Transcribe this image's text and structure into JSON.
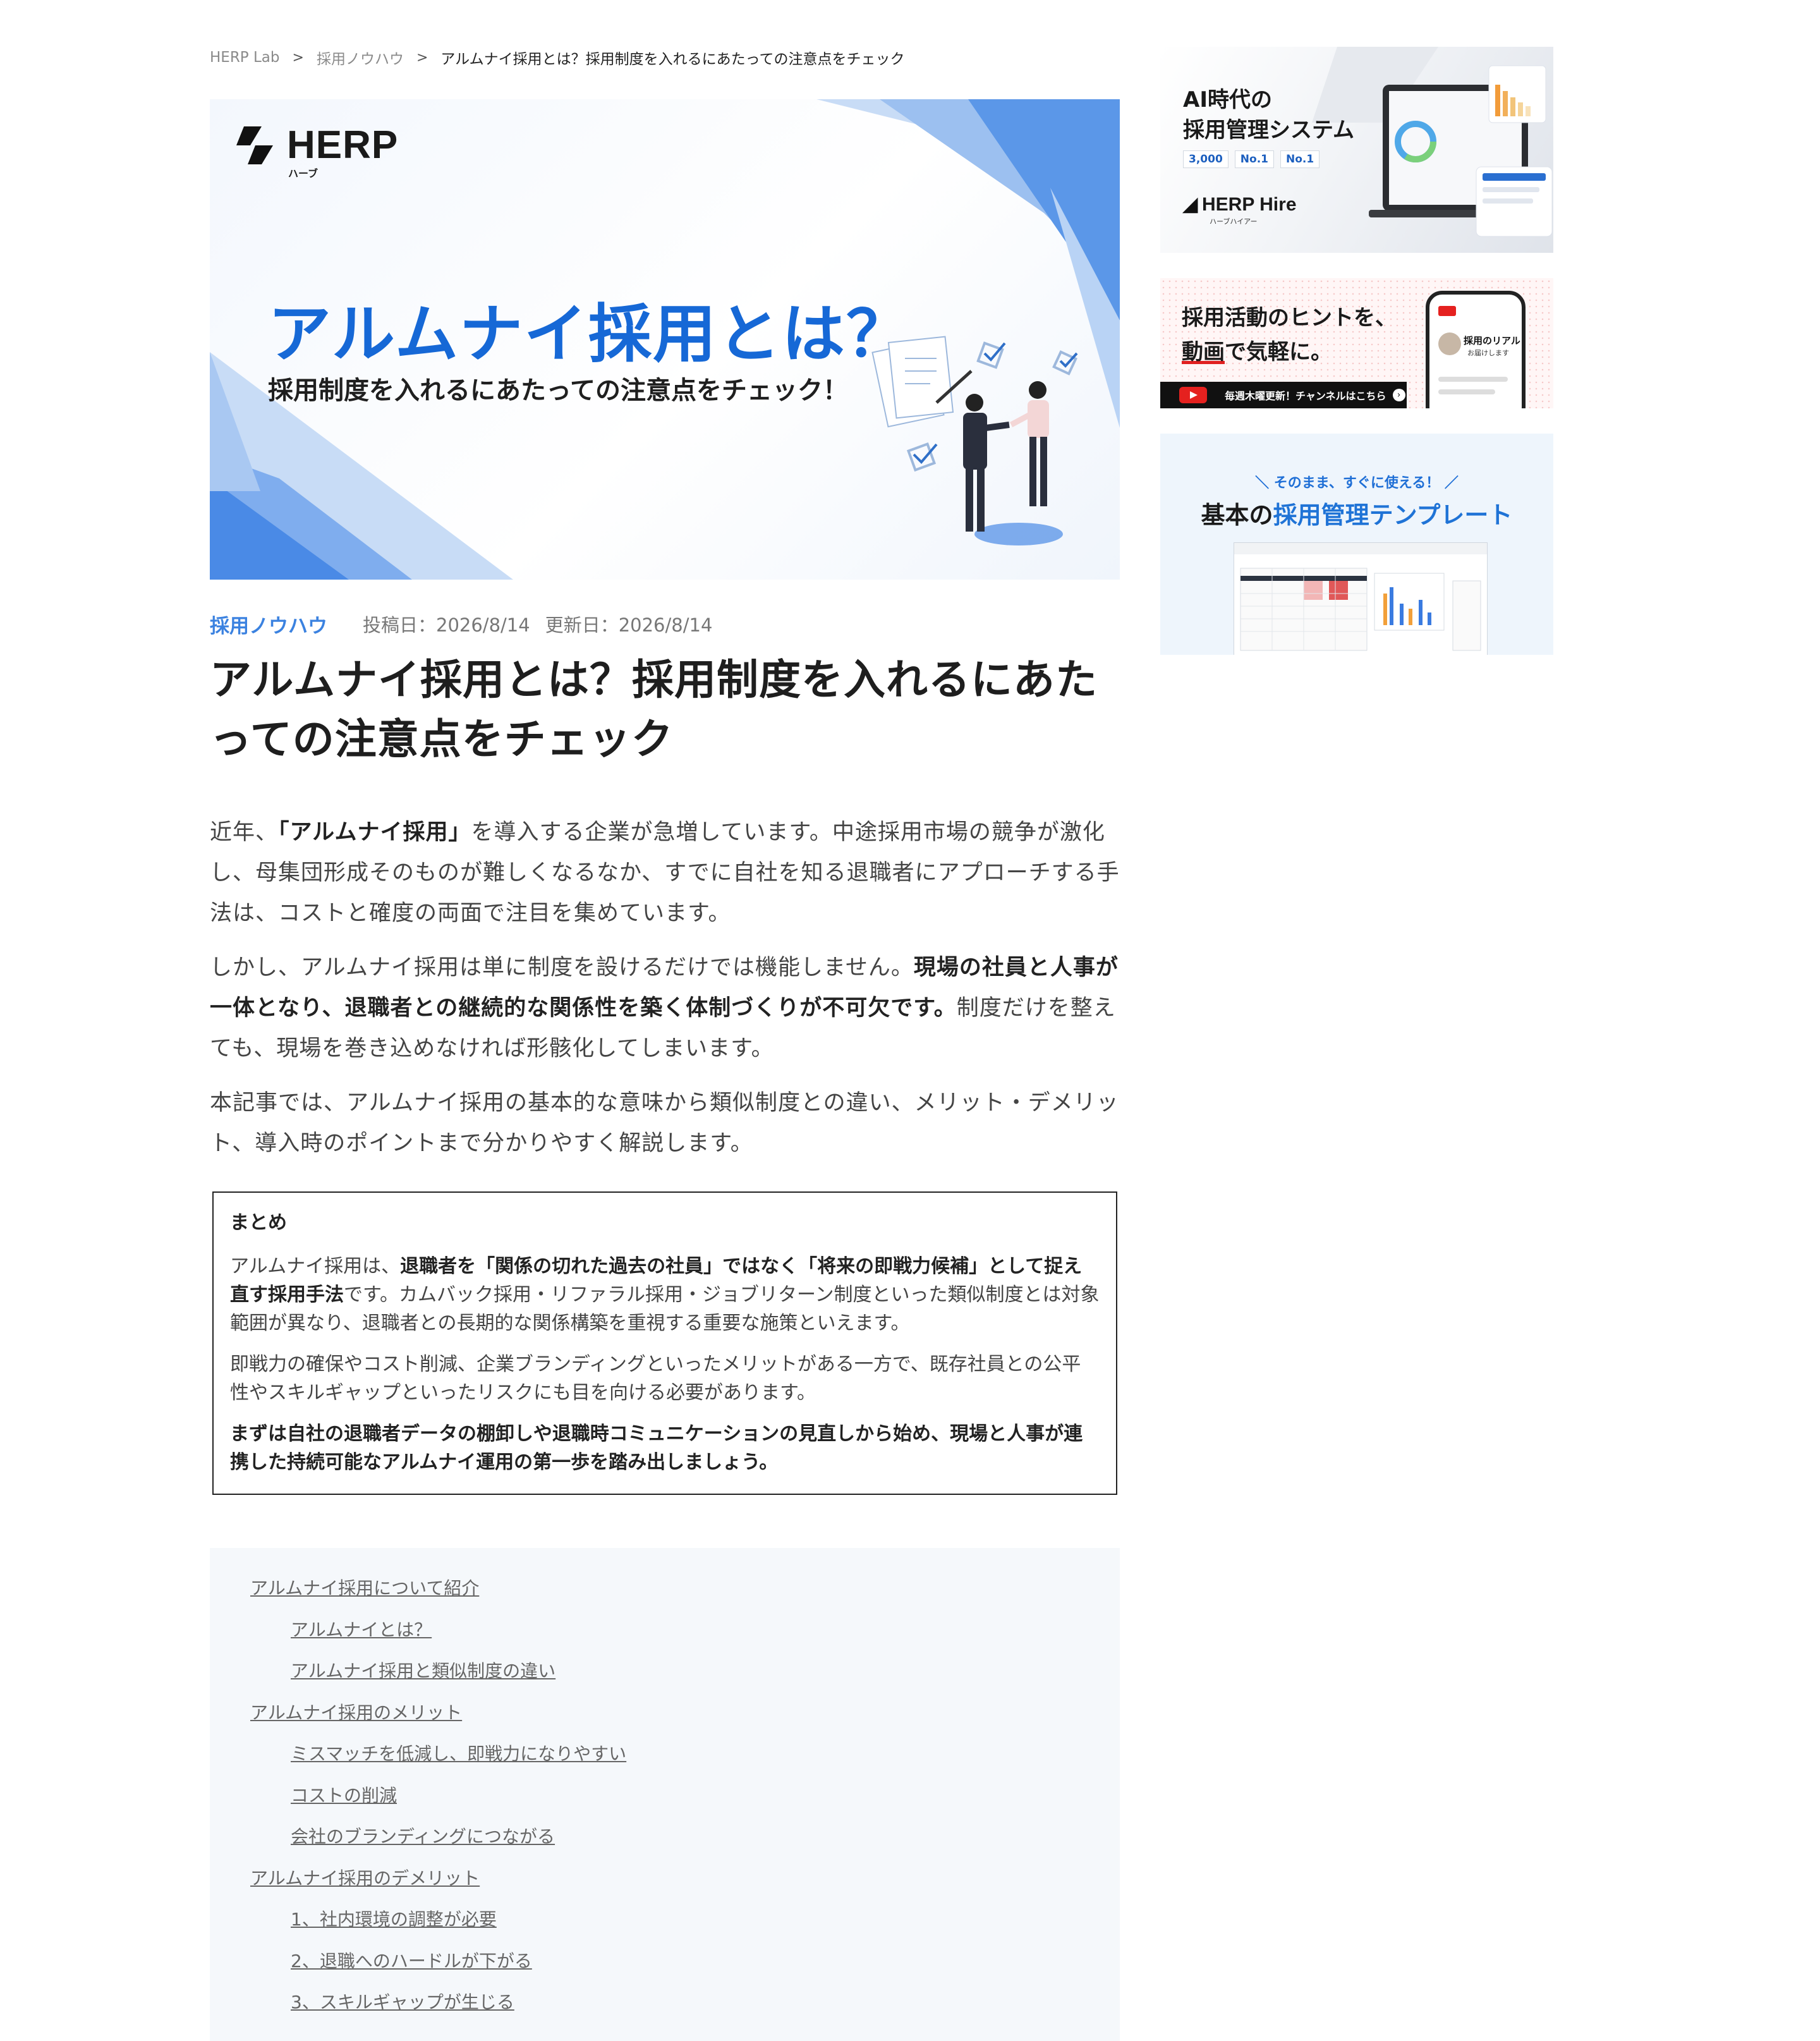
{
  "breadcrumb": {
    "items": [
      "HERP Lab",
      "採用ノウハウ"
    ],
    "current": "アルムナイ採用とは？採用制度を入れるにあたっての注意点をチェック",
    "separator": ">"
  },
  "hero": {
    "logo_text": "HERP",
    "logo_kana": "ハーブ",
    "title": "アルムナイ採用とは？",
    "subtitle": "採用制度を入れるにあたっての注意点をチェック！"
  },
  "meta": {
    "category": "採用ノウハウ",
    "posted": "投稿日：2026/8/14",
    "updated": "更新日：2026/8/14"
  },
  "article": {
    "title": "アルムナイ採用とは？採用制度を入れるにあたっての注意点をチェック",
    "p1_a": "近年、",
    "p1_b": "「アルムナイ採用」",
    "p1_c": "を導入する企業が急増しています。中途採用市場の競争が激化し、母集団形成そのものが難しくなるなか、すでに自社を知る退職者にアプローチする手法は、コストと確度の両面で注目を集めています。",
    "p2_a": "しかし、アルムナイ採用は単に制度を設けるだけでは機能しません。",
    "p2_b": "現場の社員と人事が一体となり、退職者との継続的な関係性を築く体制づくりが不可欠です。",
    "p2_c": "制度だけを整えても、現場を巻き込めなければ形骸化してしまいます。",
    "p3": "本記事では、アルムナイ採用の基本的な意味から類似制度との違い、メリット・デメリット、導入時のポイントまで分かりやすく解説します。"
  },
  "summary": {
    "heading": "まとめ",
    "s1_a": "アルムナイ採用は、",
    "s1_b": "退職者を「関係の切れた過去の社員」ではなく「将来の即戦力候補」として捉え直す採用手法",
    "s1_c": "です。カムバック採用・リファラル採用・ジョブリターン制度といった類似制度とは対象範囲が異なり、退職者との長期的な関係構築を重視する重要な施策といえます。",
    "s2": "即戦力の確保やコスト削減、企業ブランディングといったメリットがある一方で、既存社員との公平性やスキルギャップといったリスクにも目を向ける必要があります。",
    "s3": "まずは自社の退職者データの棚卸しや退職時コミュニケーションの見直しから始め、現場と人事が連携した持続可能なアルムナイ運用の第一歩を踏み出しましょう。"
  },
  "toc": {
    "items": [
      {
        "label": "アルムナイ採用について紹介",
        "level": 1
      },
      {
        "label": "アルムナイとは？",
        "level": 2
      },
      {
        "label": "アルムナイ採用と類似制度の違い",
        "level": 2
      },
      {
        "label": "アルムナイ採用のメリット",
        "level": 1
      },
      {
        "label": "ミスマッチを低減し、即戦力になりやすい",
        "level": 2
      },
      {
        "label": "コストの削減",
        "level": 2
      },
      {
        "label": "会社のブランディングにつながる",
        "level": 2
      },
      {
        "label": "アルムナイ採用のデメリット",
        "level": 1
      },
      {
        "label": "1、社内環境の調整が必要",
        "level": 2
      },
      {
        "label": "2、退職へのハードルが下がる",
        "level": 2
      },
      {
        "label": "3、スキルギャップが生じる",
        "level": 2
      }
    ]
  },
  "sidebar": {
    "banner1": {
      "title": "AI時代の\n採用管理システム",
      "badges": [
        "3,000",
        "No.1",
        "No.1"
      ],
      "logo": "HERP Hire",
      "logo_kana": "ハーブハイアー"
    },
    "banner2": {
      "title_line1": "採用活動のヒントを、",
      "title_line2_u": "動画",
      "title_line2_rest": "で気軽に。",
      "bar_text": "毎週木曜更新！チャンネルはこちら",
      "phone_caption": "採用のリアル",
      "phone_caption2": "お届けします"
    },
    "banner3": {
      "kicker": "＼ そのまま、すぐに使える！ ／",
      "title_a": "基本の",
      "title_b": "採用管理テンプレート"
    }
  },
  "colors": {
    "accent": "#1668d6",
    "category": "#3b82e0",
    "toc_bg": "#f5f8fb",
    "youtube_red": "#e5211f"
  }
}
